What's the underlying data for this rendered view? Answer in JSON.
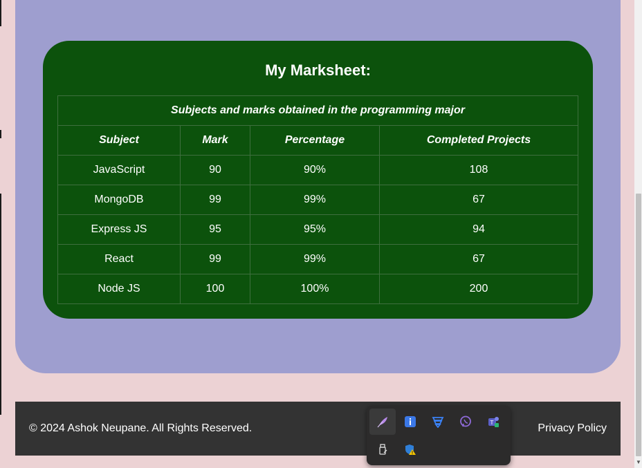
{
  "marksheet": {
    "title": "My Marksheet:",
    "caption": "Subjects and marks obtained in the programming major",
    "headers": [
      "Subject",
      "Mark",
      "Percentage",
      "Completed Projects"
    ],
    "rows": [
      [
        "JavaScript",
        "90",
        "90%",
        "108"
      ],
      [
        "MongoDB",
        "99",
        "99%",
        "67"
      ],
      [
        "Express JS",
        "95",
        "95%",
        "94"
      ],
      [
        "React",
        "99",
        "99%",
        "67"
      ],
      [
        "Node JS",
        "100",
        "100%",
        "200"
      ]
    ]
  },
  "footer": {
    "copyright": "© 2024 Ashok Neupane. All Rights Reserved.",
    "privacy": "Privacy Policy"
  },
  "tray": {
    "icons": [
      "feather-app-icon",
      "info-icon",
      "database-icon",
      "viber-icon",
      "teams-icon",
      "usb-drive-icon",
      "defender-warning-icon"
    ]
  },
  "colors": {
    "page_background": "#ecd2d4",
    "panel": "#9e9ecf",
    "card": "#0c520c",
    "footer": "#333333"
  }
}
